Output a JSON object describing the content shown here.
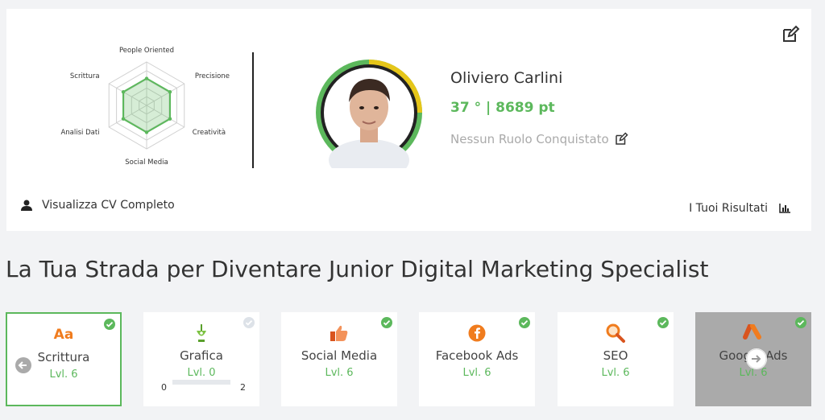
{
  "profile": {
    "name": "Oliviero Carlini",
    "score": "37 ° | 8689 pt",
    "role": "Nessun Ruolo Conquistato"
  },
  "radar": {
    "labels": [
      "People Oriented",
      "Precisione",
      "Creatività",
      "Social Media",
      "Analisi Dati",
      "Scrittura"
    ],
    "values": [
      0.62,
      0.62,
      0.62,
      0.62,
      0.62,
      0.62
    ],
    "accent": "#5cb85c"
  },
  "actions": {
    "cv_label": "Visualizza CV Completo",
    "results_label": "I Tuoi Risultati"
  },
  "path_title": "La Tua Strada per Diventare Junior Digital Marketing Specialist",
  "skills": [
    {
      "name": "Scrittura",
      "level": "Lvl. 6",
      "icon": "text-aa-icon",
      "completed": true,
      "active": true
    },
    {
      "name": "Grafica",
      "level": "Lvl. 0",
      "icon": "pen-tool-icon",
      "completed": false,
      "progress_min": "0",
      "progress_max": "2",
      "progress": 0
    },
    {
      "name": "Social Media",
      "level": "Lvl. 6",
      "icon": "thumbs-up-icon",
      "completed": true
    },
    {
      "name": "Facebook Ads",
      "level": "Lvl. 6",
      "icon": "facebook-icon",
      "completed": true
    },
    {
      "name": "SEO",
      "level": "Lvl. 6",
      "icon": "magnifier-icon",
      "completed": true
    },
    {
      "name": "Google Ads",
      "level": "Lvl. 6",
      "icon": "google-ads-icon",
      "completed": true,
      "locked": true
    }
  ],
  "colors": {
    "accent": "#5cb85c",
    "icon_orange": "#f07c1e"
  }
}
